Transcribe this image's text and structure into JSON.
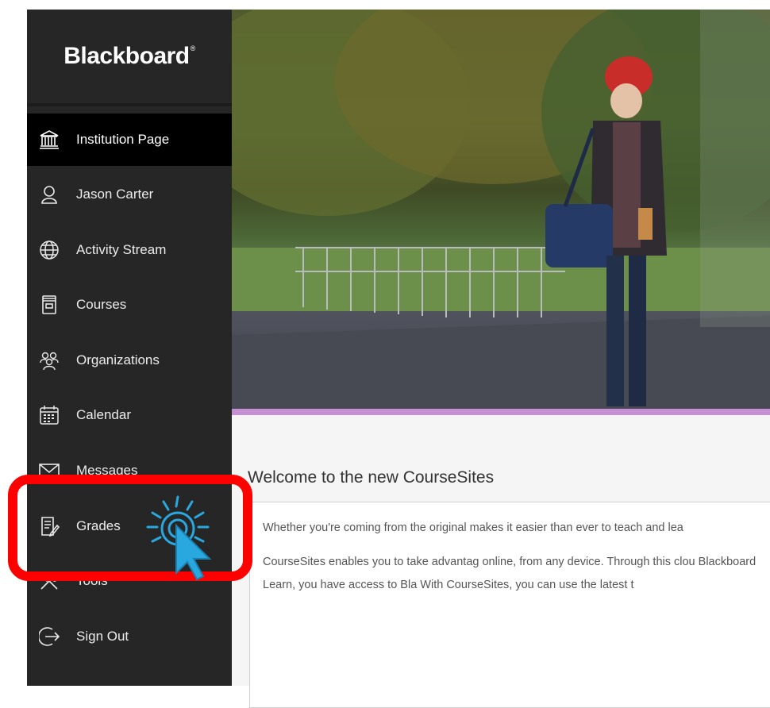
{
  "brand": {
    "name": "Blackboard",
    "mark": "®"
  },
  "sidebar": {
    "items": [
      {
        "label": "Institution Page",
        "icon": "institution-icon",
        "active": true
      },
      {
        "label": "Jason Carter",
        "icon": "user-icon"
      },
      {
        "label": "Activity Stream",
        "icon": "globe-icon"
      },
      {
        "label": "Courses",
        "icon": "courses-icon"
      },
      {
        "label": "Organizations",
        "icon": "organizations-icon"
      },
      {
        "label": "Calendar",
        "icon": "calendar-icon"
      },
      {
        "label": "Messages",
        "icon": "envelope-icon"
      },
      {
        "label": "Grades",
        "icon": "grades-icon"
      },
      {
        "label": "Tools",
        "icon": "tools-icon"
      },
      {
        "label": "Sign Out",
        "icon": "sign-out-icon"
      }
    ]
  },
  "main": {
    "welcome_title": "Welcome to the new CourseSites",
    "paragraphs": [
      "Whether you're coming from the original makes it easier than ever to teach and lea",
      "CourseSites enables you to take advantag online, from any device. Through this clou Blackboard Learn, you have access to Bla With CourseSites, you can use the latest t"
    ]
  },
  "colors": {
    "sidebar": "#262626",
    "accent_bar": "#c58fd3",
    "highlight": "#ff0000",
    "cursor": "#29a8e0"
  }
}
